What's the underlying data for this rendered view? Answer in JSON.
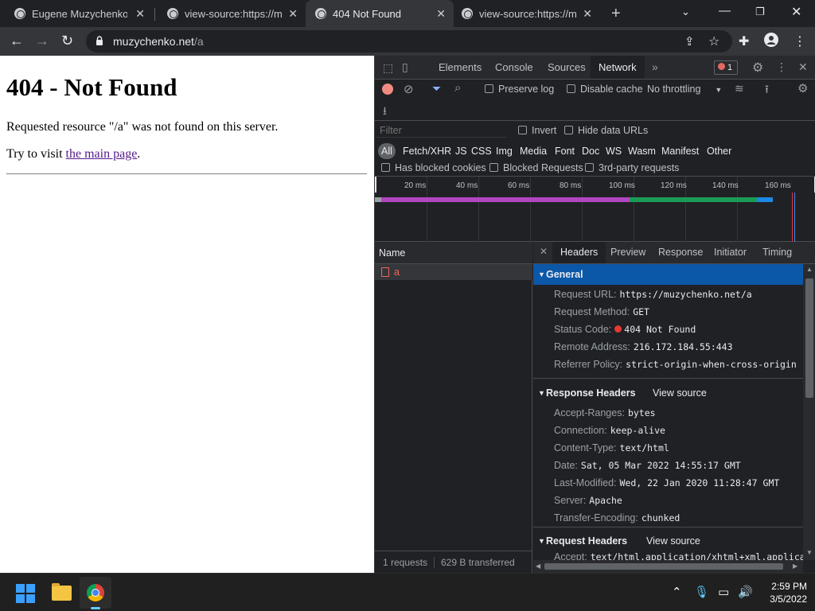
{
  "browser": {
    "tabs": [
      {
        "label": "Eugene Muzychenko",
        "active": false
      },
      {
        "label": "view-source:https://muzychenko.net",
        "active": false
      },
      {
        "label": "404 Not Found",
        "active": true
      },
      {
        "label": "view-source:https://muzychenko.net",
        "active": false
      }
    ],
    "url_host": "muzychenko.net",
    "url_path": "/a"
  },
  "page": {
    "heading": "404 - Not Found",
    "message": "Requested resource \"/a\" was not found on this server.",
    "visit_prefix": "Try to visit ",
    "link_text": "the main page",
    "visit_suffix": "."
  },
  "devtools": {
    "tabs": [
      "Elements",
      "Console",
      "Sources",
      "Network"
    ],
    "active_tab": "Network",
    "error_count": "1",
    "toolbar": {
      "preserve_log": "Preserve log",
      "disable_cache": "Disable cache",
      "throttling": "No throttling"
    },
    "filter": {
      "placeholder": "Filter",
      "invert": "Invert",
      "hide_data_urls": "Hide data URLs",
      "types": [
        "All",
        "Fetch/XHR",
        "JS",
        "CSS",
        "Img",
        "Media",
        "Font",
        "Doc",
        "WS",
        "Wasm",
        "Manifest",
        "Other"
      ],
      "has_blocked_cookies": "Has blocked cookies",
      "blocked_requests": "Blocked Requests",
      "third_party": "3rd-party requests"
    },
    "timeline_ticks": [
      "20 ms",
      "40 ms",
      "60 ms",
      "80 ms",
      "100 ms",
      "120 ms",
      "140 ms",
      "160 ms"
    ],
    "requests": {
      "column_name": "Name",
      "rows": [
        {
          "name": "a",
          "status": "error"
        }
      ],
      "summary_count": "1 requests",
      "summary_transferred": "629 B transferred"
    },
    "detail_tabs": [
      "Headers",
      "Preview",
      "Response",
      "Initiator",
      "Timing"
    ],
    "general": {
      "title": "General",
      "rows": [
        {
          "k": "Request URL:",
          "v": "https://muzychenko.net/a"
        },
        {
          "k": "Request Method:",
          "v": "GET"
        },
        {
          "k": "Status Code:",
          "v": "404 Not Found"
        },
        {
          "k": "Remote Address:",
          "v": "216.172.184.55:443"
        },
        {
          "k": "Referrer Policy:",
          "v": "strict-origin-when-cross-origin"
        }
      ]
    },
    "response_headers": {
      "title": "Response Headers",
      "view_source": "View source",
      "rows": [
        {
          "k": "Accept-Ranges:",
          "v": "bytes"
        },
        {
          "k": "Connection:",
          "v": "keep-alive"
        },
        {
          "k": "Content-Type:",
          "v": "text/html"
        },
        {
          "k": "Date:",
          "v": "Sat, 05 Mar 2022 14:55:17 GMT"
        },
        {
          "k": "Last-Modified:",
          "v": "Wed, 22 Jan 2020 11:28:47 GMT"
        },
        {
          "k": "Server:",
          "v": "Apache"
        },
        {
          "k": "Transfer-Encoding:",
          "v": "chunked"
        }
      ]
    },
    "request_headers": {
      "title": "Request Headers",
      "view_source": "View source",
      "rows": [
        {
          "k": "Accept:",
          "v": "text/html,application/xhtml+xml,applica"
        }
      ]
    }
  },
  "taskbar": {
    "time": "2:59 PM",
    "date": "3/5/2022"
  }
}
